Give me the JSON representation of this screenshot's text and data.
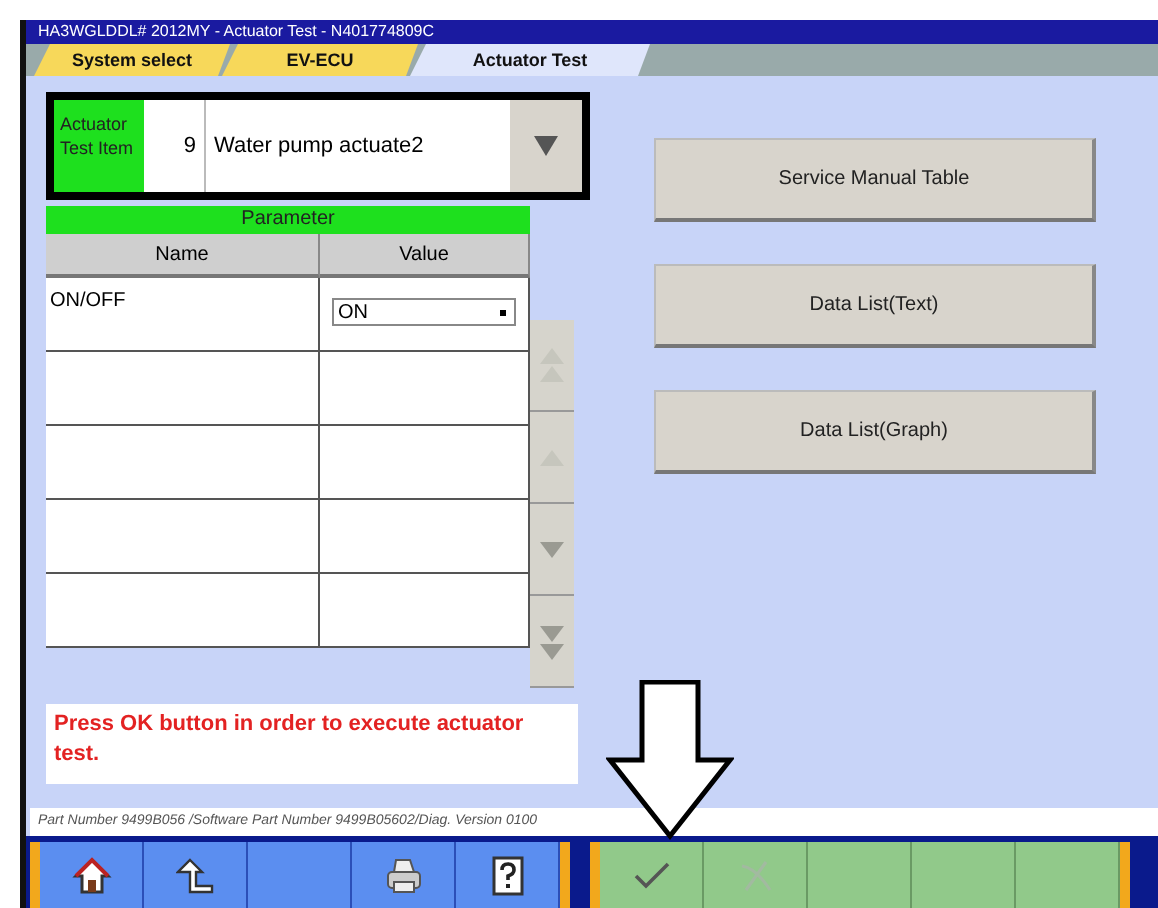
{
  "window": {
    "title": "HA3WGLDDL# 2012MY  -  Actuator Test  -  N401774809C"
  },
  "tabs": [
    {
      "label": "System select",
      "selected": false
    },
    {
      "label": "EV-ECU",
      "selected": false
    },
    {
      "label": "Actuator Test",
      "selected": true
    }
  ],
  "actuator_item": {
    "label": "Actuator Test Item",
    "number": "9",
    "name": "Water pump actuate2"
  },
  "parameter_table": {
    "title": "Parameter",
    "columns": [
      "Name",
      "Value"
    ],
    "rows": [
      {
        "name": "ON/OFF",
        "value": "ON"
      }
    ],
    "scroll_buttons": [
      {
        "kind": "top",
        "disabled": true
      },
      {
        "kind": "up",
        "disabled": true
      },
      {
        "kind": "down",
        "disabled": false
      },
      {
        "kind": "bottom",
        "disabled": false
      }
    ]
  },
  "message": "Press OK button in order to execute actuator test.",
  "side_buttons": [
    "Service Manual Table",
    "Data List(Text)",
    "Data List(Graph)"
  ],
  "part_number": "Part Number 9499B056  /Software Part Number 9499B05602/Diag.  Version 0100",
  "toolbar_left": [
    {
      "kind": "home"
    },
    {
      "kind": "back"
    },
    {
      "kind": "blank"
    },
    {
      "kind": "print"
    },
    {
      "kind": "help"
    }
  ],
  "toolbar_right": [
    {
      "kind": "ok",
      "disabled": false
    },
    {
      "kind": "cancel",
      "disabled": true
    },
    {
      "kind": "blank"
    },
    {
      "kind": "blank"
    },
    {
      "kind": "blank"
    }
  ]
}
